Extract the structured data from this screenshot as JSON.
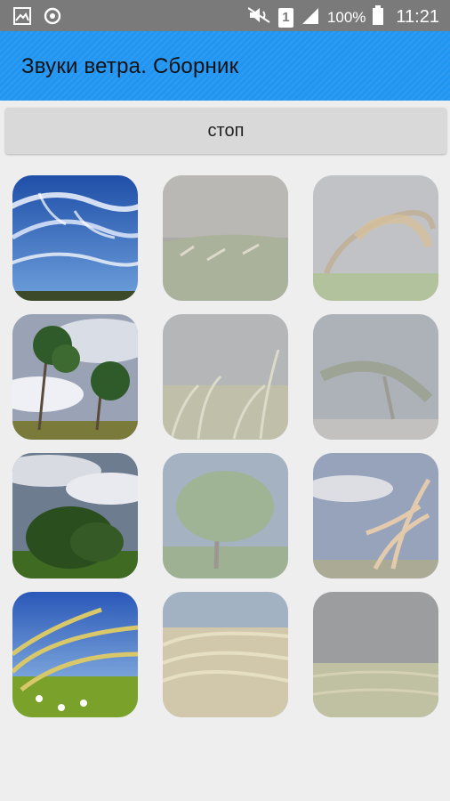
{
  "status_bar": {
    "battery": "100%",
    "time": "11:21",
    "sim_slot": "1",
    "icons": [
      "image-icon",
      "sync-icon",
      "mute-icon",
      "sim-icon",
      "signal-icon",
      "battery-icon"
    ]
  },
  "app_bar": {
    "title": "Звуки ветра. Сборник",
    "color": "#2195f2"
  },
  "controls": {
    "stop_label": "стоп"
  },
  "sound_tiles": [
    {
      "name": "sky-cirrus",
      "active": true
    },
    {
      "name": "field-storm",
      "active": false
    },
    {
      "name": "bent-tree",
      "active": false
    },
    {
      "name": "windy-trees",
      "active": true
    },
    {
      "name": "grass-wind",
      "active": false
    },
    {
      "name": "windswept-tree",
      "active": false
    },
    {
      "name": "green-bush",
      "active": true
    },
    {
      "name": "bending-tree",
      "active": false
    },
    {
      "name": "grass-plume",
      "active": false
    },
    {
      "name": "wheat-ears",
      "active": true
    },
    {
      "name": "tall-grass",
      "active": false
    },
    {
      "name": "dark-field",
      "active": false
    }
  ]
}
